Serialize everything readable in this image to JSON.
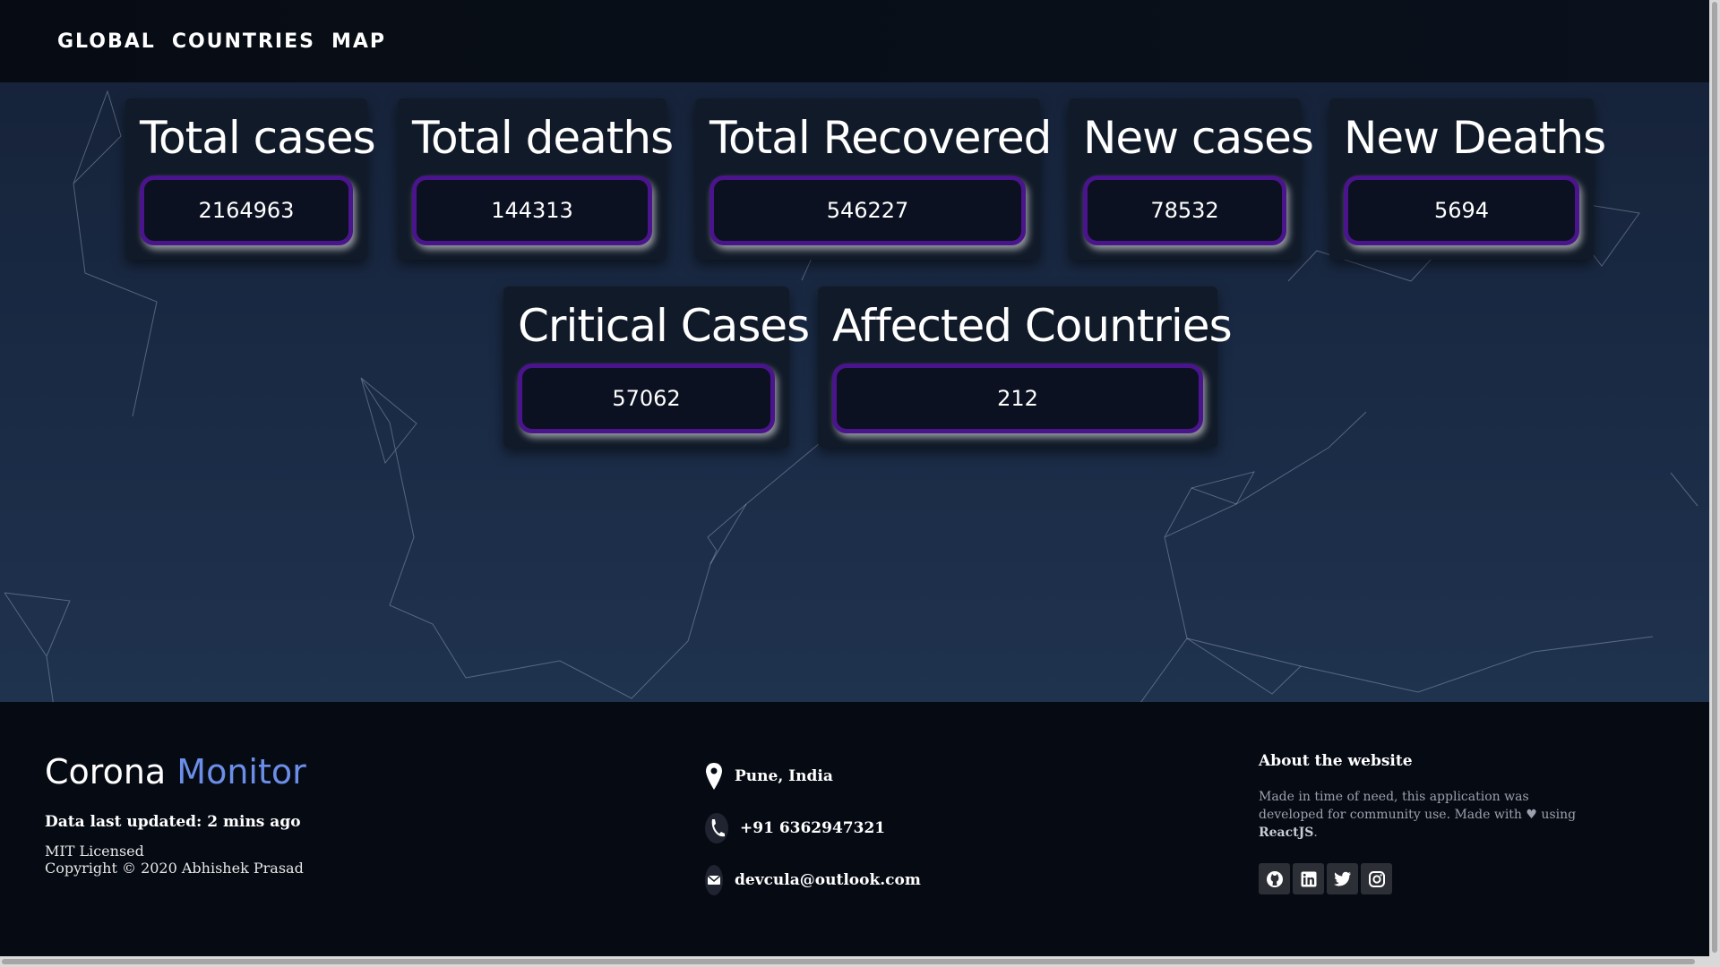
{
  "nav": {
    "links": [
      "GLOBAL",
      "COUNTRIES",
      "MAP"
    ]
  },
  "stats": {
    "total_cases": {
      "label": "Total cases",
      "value": "2164963"
    },
    "total_deaths": {
      "label": "Total deaths",
      "value": "144313"
    },
    "total_recovered": {
      "label": "Total Recovered",
      "value": "546227"
    },
    "new_cases": {
      "label": "New cases",
      "value": "78532"
    },
    "new_deaths": {
      "label": "New Deaths",
      "value": "5694"
    },
    "critical_cases": {
      "label": "Critical Cases",
      "value": "57062"
    },
    "affected_countries": {
      "label": "Affected Countries",
      "value": "212"
    }
  },
  "footer": {
    "brand_part1": "Corona",
    "brand_part2": "Monitor",
    "updated": "Data last updated: 2 mins ago",
    "license": "MIT Licensed",
    "copyright": "Copyright © 2020 Abhishek Prasad",
    "contacts": {
      "location": "Pune, India",
      "phone": "+91 6362947321",
      "email": "devcula@outlook.com"
    },
    "about_title": "About the website",
    "about_text_1": "Made in time of need, this application was developed for community use. Made with",
    "about_text_2": "using",
    "about_tech": "ReactJS",
    "about_end": ".",
    "social_icons": [
      "github-icon",
      "linkedin-icon",
      "twitter-icon",
      "instagram-icon"
    ]
  },
  "colors": {
    "accent": "#4a148c",
    "brand_accent": "#6b8ee8",
    "bg": "#16233a"
  }
}
